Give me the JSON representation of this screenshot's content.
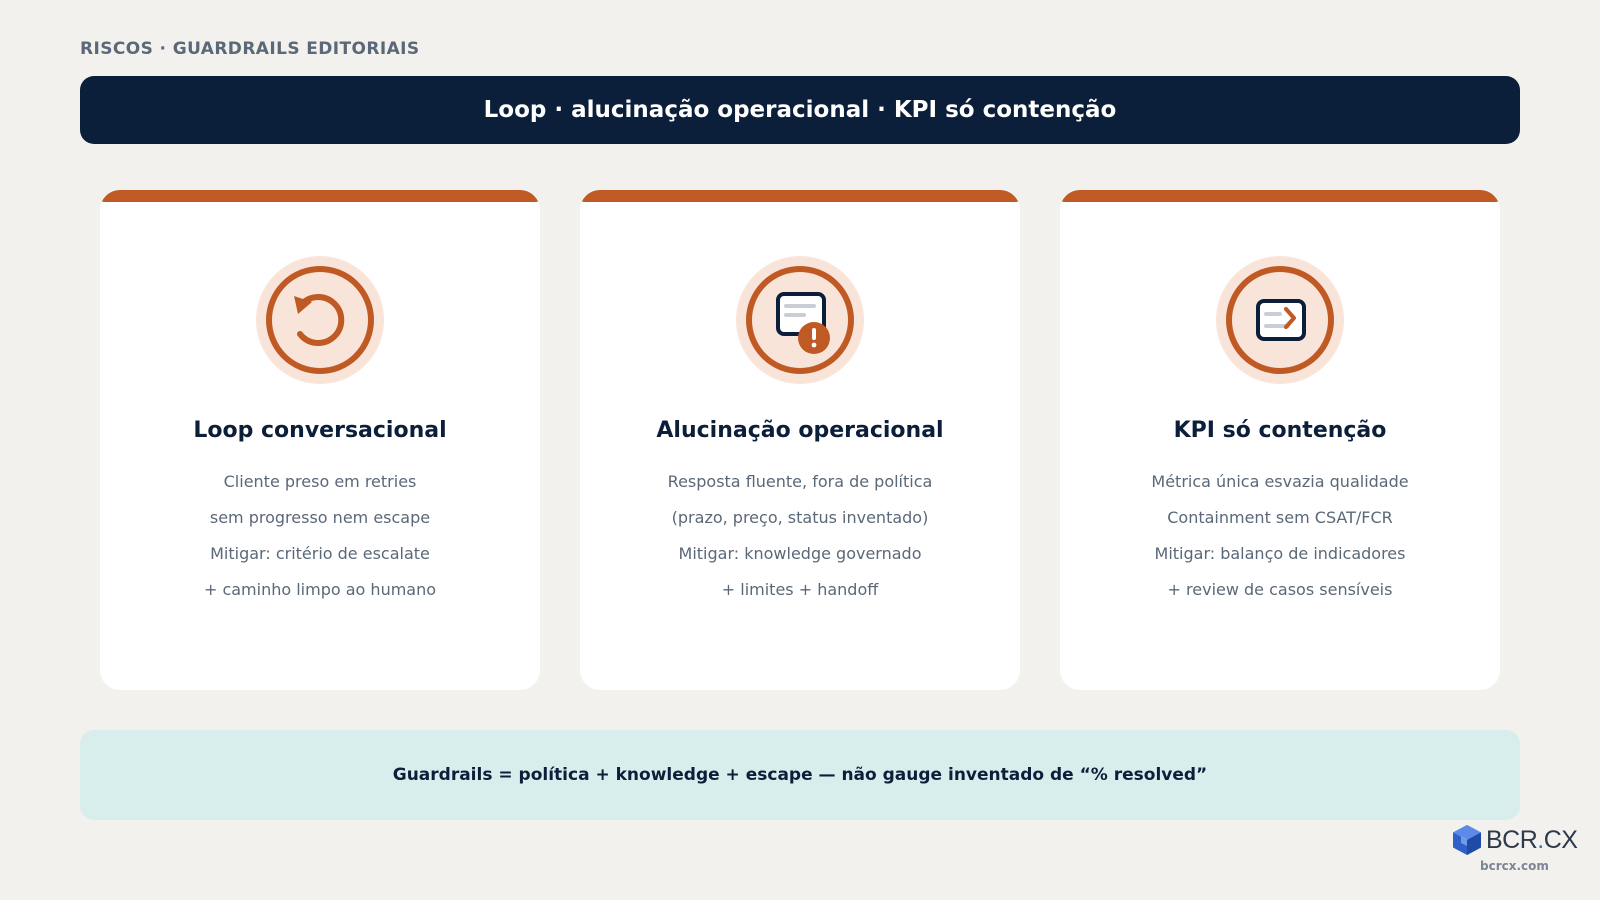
{
  "header": {
    "eyebrow": "RISCOS · GUARDRAILS EDITORIAIS",
    "title": "Loop · alucinação operacional · KPI só contenção"
  },
  "cards": [
    {
      "icon": "refresh-loop-icon",
      "title": "Loop conversacional",
      "lines": [
        "Cliente preso em retries",
        "sem progresso nem escape",
        "Mitigar: critério de escalate",
        "+ caminho limpo ao humano"
      ]
    },
    {
      "icon": "document-alert-icon",
      "title": "Alucinação operacional",
      "lines": [
        "Resposta fluente, fora de política",
        "(prazo, preço, status inventado)",
        "Mitigar: knowledge governado",
        "+ limites + handoff"
      ]
    },
    {
      "icon": "message-forward-icon",
      "title": "KPI só contenção",
      "lines": [
        "Métrica única esvazia qualidade",
        "Containment sem CSAT/FCR",
        "Mitigar: balanço de indicadores",
        "+ review de casos sensíveis"
      ]
    }
  ],
  "summary": {
    "text": "Guardrails = política + knowledge + escape — não gauge inventado de “% resolved”"
  },
  "logo": {
    "brand_main": "BCR",
    "brand_dot": ".",
    "brand_suffix": "CX",
    "url": "bcrcx.com"
  },
  "colors": {
    "background": "#f3f1ee",
    "navy": "#0c1f3a",
    "accent": "#c05a24",
    "icon_bg": "#f9e4da",
    "muted_text": "#5b6878",
    "summary_bg": "#d7eeed"
  }
}
